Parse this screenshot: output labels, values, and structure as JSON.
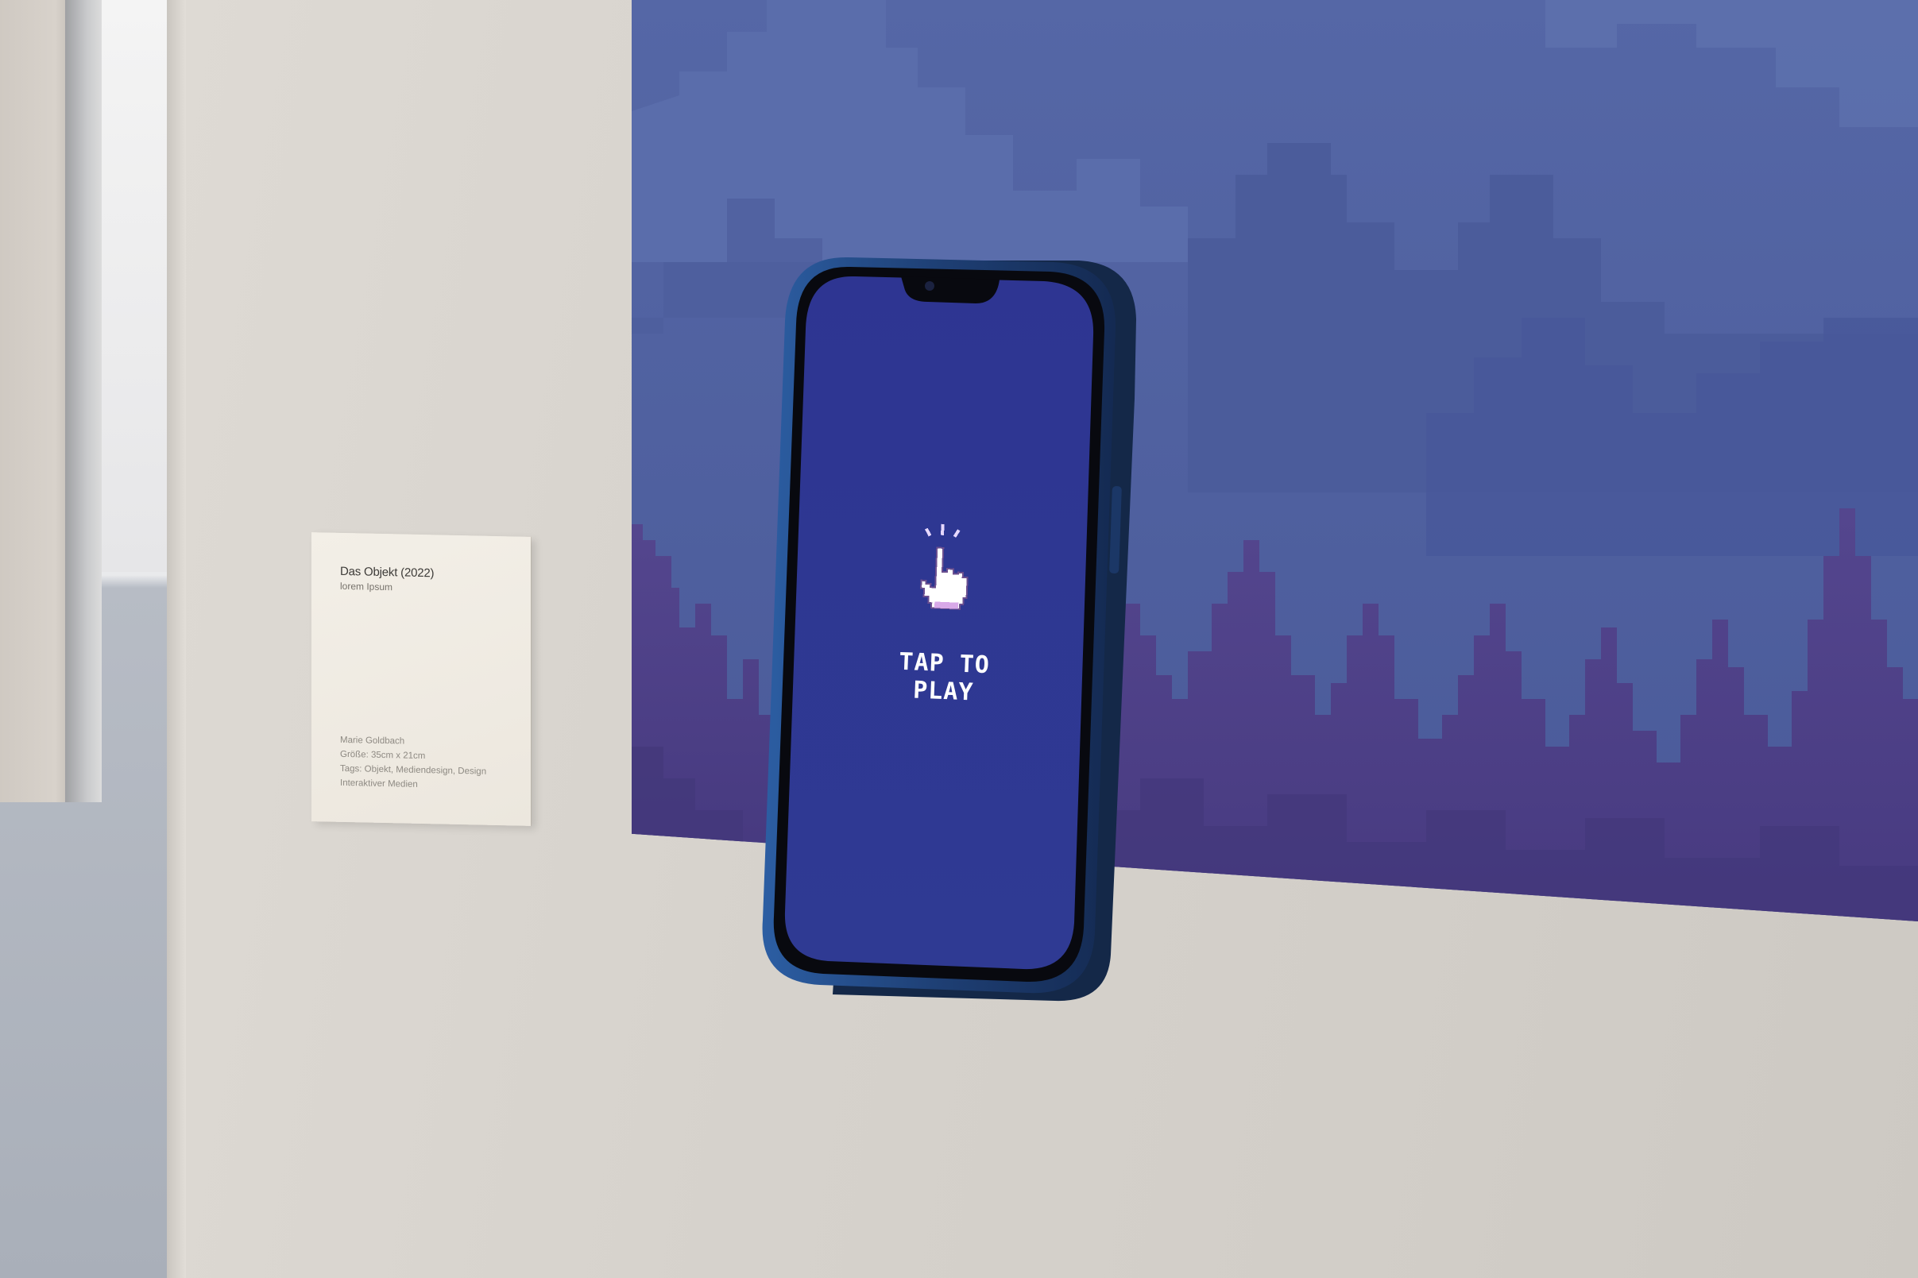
{
  "placard": {
    "title": "Das Objekt (2022)",
    "subtitle": "lorem Ipsum",
    "artist": "Marie Goldbach",
    "size": "Größe: 35cm x 21cm",
    "tags_line1": "Tags: Objekt, Mediendesign, Design",
    "tags_line2": "Interaktiver Medien"
  },
  "phone_screen": {
    "prompt": "TAP TO PLAY",
    "icon": "tap-hand-icon",
    "background_color": "#2e3490"
  },
  "colors": {
    "artwork_sky": "#5265a3",
    "artwork_mountains": "#4a5994",
    "artwork_foreground": "#4b3f86",
    "wall": "#d6d2cc",
    "phone_frame": "#1f3f73"
  }
}
